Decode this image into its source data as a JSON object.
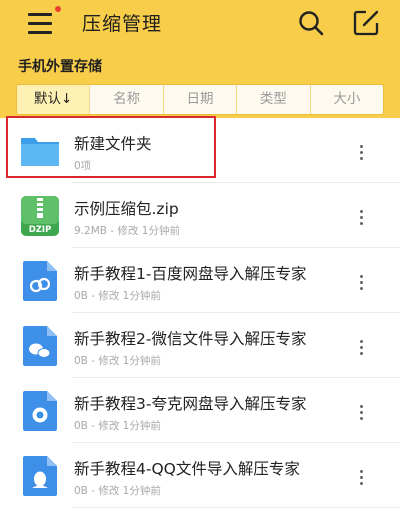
{
  "header": {
    "title": "压缩管理",
    "storage_label": "手机外置存储"
  },
  "icons": {
    "menu": "hamburger-menu-icon",
    "search": "search-icon",
    "edit": "edit-icon"
  },
  "colors": {
    "header_bg": "#f7cd4a",
    "badge": "#e8402d",
    "highlight": "#d8292f"
  },
  "sort_tabs": [
    "默认↓",
    "名称",
    "日期",
    "类型",
    "大小"
  ],
  "files": [
    {
      "name": "新建文件夹",
      "meta": "0项",
      "icon": "folder-icon"
    },
    {
      "name": "示例压缩包.zip",
      "meta": "9.2MB - 修改 1分钟前",
      "icon": "zip-file-icon",
      "icon_label": "DZIP"
    },
    {
      "name": "新手教程1-百度网盘导入解压专家",
      "meta": "0B - 修改 1分钟前",
      "icon": "baidu-doc-icon"
    },
    {
      "name": "新手教程2-微信文件导入解压专家",
      "meta": "0B - 修改 1分钟前",
      "icon": "wechat-doc-icon"
    },
    {
      "name": "新手教程3-夸克网盘导入解压专家",
      "meta": "0B - 修改 1分钟前",
      "icon": "quark-doc-icon"
    },
    {
      "name": "新手教程4-QQ文件导入解压专家",
      "meta": "0B - 修改 1分钟前",
      "icon": "qq-doc-icon"
    }
  ]
}
